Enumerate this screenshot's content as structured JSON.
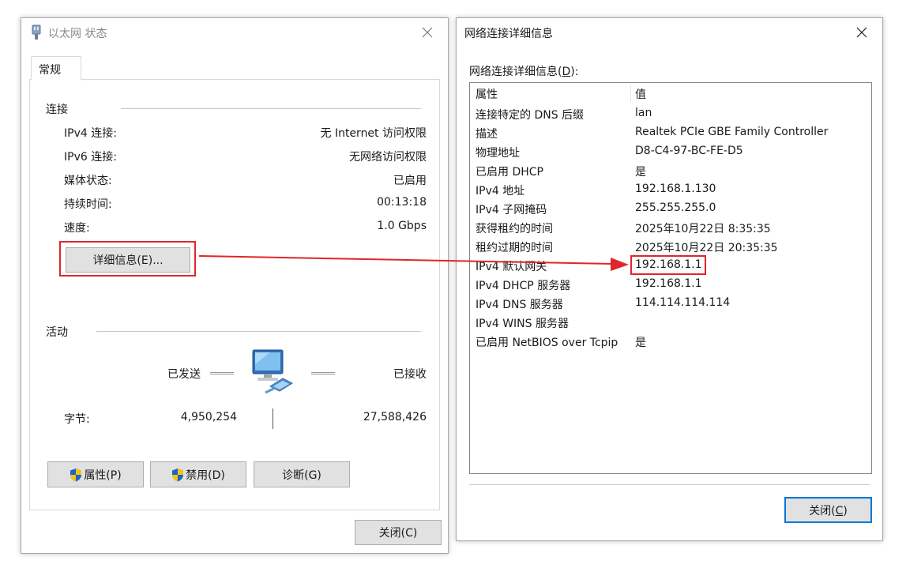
{
  "status_window": {
    "title": "以太网 状态",
    "tab": "常规",
    "connection_group": "连接",
    "rows": [
      {
        "label": "IPv4 连接:",
        "value": "无 Internet 访问权限"
      },
      {
        "label": "IPv6 连接:",
        "value": "无网络访问权限"
      },
      {
        "label": "媒体状态:",
        "value": "已启用"
      },
      {
        "label": "持续时间:",
        "value": "00:13:18"
      },
      {
        "label": "速度:",
        "value": "1.0 Gbps"
      }
    ],
    "details_button": "详细信息(E)...",
    "activity_group": "活动",
    "sent_label": "已发送",
    "received_label": "已接收",
    "bytes_label": "字节:",
    "bytes_sent": "4,950,254",
    "bytes_received": "27,588,426",
    "properties_button": "属性(P)",
    "disable_button": "禁用(D)",
    "diagnose_button": "诊断(G)",
    "close_button": "关闭(C)"
  },
  "details_window": {
    "title": "网络连接详细信息",
    "list_label_prefix": "网络连接详细信息(",
    "list_label_key": "D",
    "list_label_suffix": "):",
    "header_property": "属性",
    "header_value": "值",
    "rows": [
      {
        "property": "连接特定的 DNS 后缀",
        "value": "lan"
      },
      {
        "property": "描述",
        "value": "Realtek PCIe GBE Family Controller"
      },
      {
        "property": "物理地址",
        "value": "D8-C4-97-BC-FE-D5"
      },
      {
        "property": "已启用 DHCP",
        "value": "是"
      },
      {
        "property": "IPv4 地址",
        "value": "192.168.1.130"
      },
      {
        "property": "IPv4 子网掩码",
        "value": "255.255.255.0"
      },
      {
        "property": "获得租约的时间",
        "value": "2025年10月22日 8:35:35"
      },
      {
        "property": "租约过期的时间",
        "value": "2025年10月22日 20:35:35"
      },
      {
        "property": "IPv4 默认网关",
        "value": "192.168.1.1"
      },
      {
        "property": "IPv4 DHCP 服务器",
        "value": "192.168.1.1"
      },
      {
        "property": "IPv4 DNS 服务器",
        "value": "114.114.114.114"
      },
      {
        "property": "IPv4 WINS 服务器",
        "value": ""
      },
      {
        "property": "已启用 NetBIOS over Tcpip",
        "value": "是"
      }
    ],
    "close_prefix": "关闭(",
    "close_key": "C",
    "close_suffix": ")"
  },
  "colors": {
    "highlight_red": "#e0262a",
    "focus_blue": "#0078d7",
    "button_face": "#e1e1e1"
  },
  "icons": [
    "ethernet-icon",
    "close-icon",
    "network-computer-icon",
    "uac-shield-icon"
  ]
}
